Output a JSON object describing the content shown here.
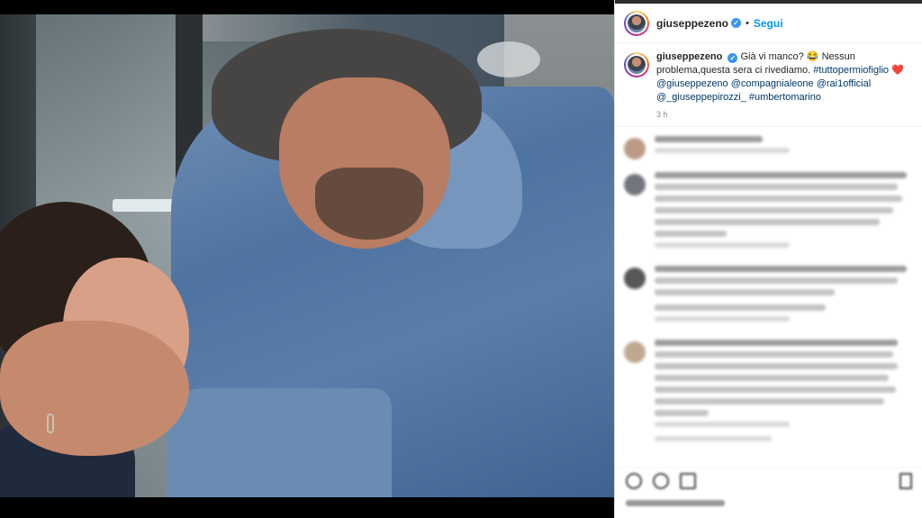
{
  "post": {
    "username": "giuseppezeno",
    "verified_mark": "✓",
    "separator": "•",
    "follow_label": "Segui",
    "caption": {
      "username": "giuseppezeno",
      "text_part1": "Già vi manco? 😂 Nessun problema,questa sera ci rivediamo.",
      "hashtag": "#tuttopermiofiglio",
      "heart": "❤️",
      "mention1": "@giuseppezeno",
      "mention2": "@compagnialeone",
      "mention3": "@rai1official",
      "mention4": "@_giuseppepirozzi_",
      "hashtag2": "#umbertomarino"
    },
    "time": "3 h"
  },
  "icons": {
    "like": "heart-icon",
    "comment": "comment-icon",
    "share": "share-icon",
    "save": "bookmark-icon"
  },
  "colors": {
    "link": "#00376b",
    "follow": "#0095f6",
    "verified": "#3897f0"
  }
}
